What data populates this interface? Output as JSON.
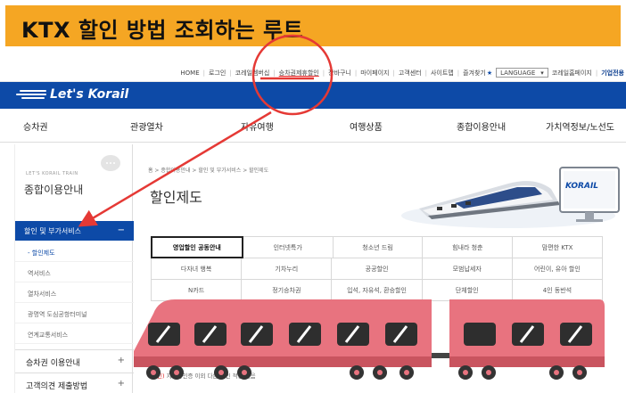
{
  "banner": {
    "title": "KTX 할인 방법 조회하는 루트"
  },
  "util_bar": {
    "links": [
      "HOME",
      "로그인",
      "코레일멤버십",
      "승차권제휴할인",
      "장바구니",
      "마이페이지",
      "고객센터",
      "사이트맵",
      "즐겨찾기"
    ],
    "language_label": "LANGUAGE",
    "homepage": "코레일홈페이지",
    "corporate": "기업전용"
  },
  "logo": {
    "text": "Let's Korail"
  },
  "main_nav": {
    "items": [
      "승차권",
      "관광열차",
      "자유여행",
      "여행상품",
      "종합이용안내",
      "가치역정보/노선도"
    ]
  },
  "sidebar": {
    "subtitle": "LET'S KORAIL TRAIN",
    "title": "종합이용안내",
    "active_group": "할인 및 부가서비스",
    "active_toggle": "−",
    "sub_items": [
      "- 할인제도",
      "역서비스",
      "열차서비스",
      "광명역 도심공항터미널",
      "연계교통서비스"
    ],
    "groups": [
      {
        "label": "승차권 이용안내",
        "toggle": "+"
      },
      {
        "label": "고객의견 제출방법",
        "toggle": "+"
      }
    ]
  },
  "content": {
    "breadcrumb": "홈 > 종합이용안내 > 할인 및 부가서비스 > 할인제도",
    "page_title": "할인제도",
    "monitor_logo": "KORAIL",
    "tabs": [
      [
        "영업할인 공동안내",
        "인터넷특가",
        "청소년 드림",
        "힘내라 청춘",
        "맘편한 KTX"
      ],
      [
        "다자녀 행복",
        "기차누리",
        "공공할인",
        "모범납세자",
        "어린이, 유아 할인"
      ],
      [
        "N카드",
        "정기승차권",
        "입석, 자유석, 환승할인",
        "단체할인",
        "4인 동반석"
      ]
    ],
    "body_red": "할인)",
    "body_text": "지연할인증 이외 다른 할인 적용 없음"
  },
  "colors": {
    "banner": "#f5a623",
    "brand_blue": "#0d4aa7",
    "annotation_red": "#e53935",
    "train_pink": "#e8737f"
  }
}
